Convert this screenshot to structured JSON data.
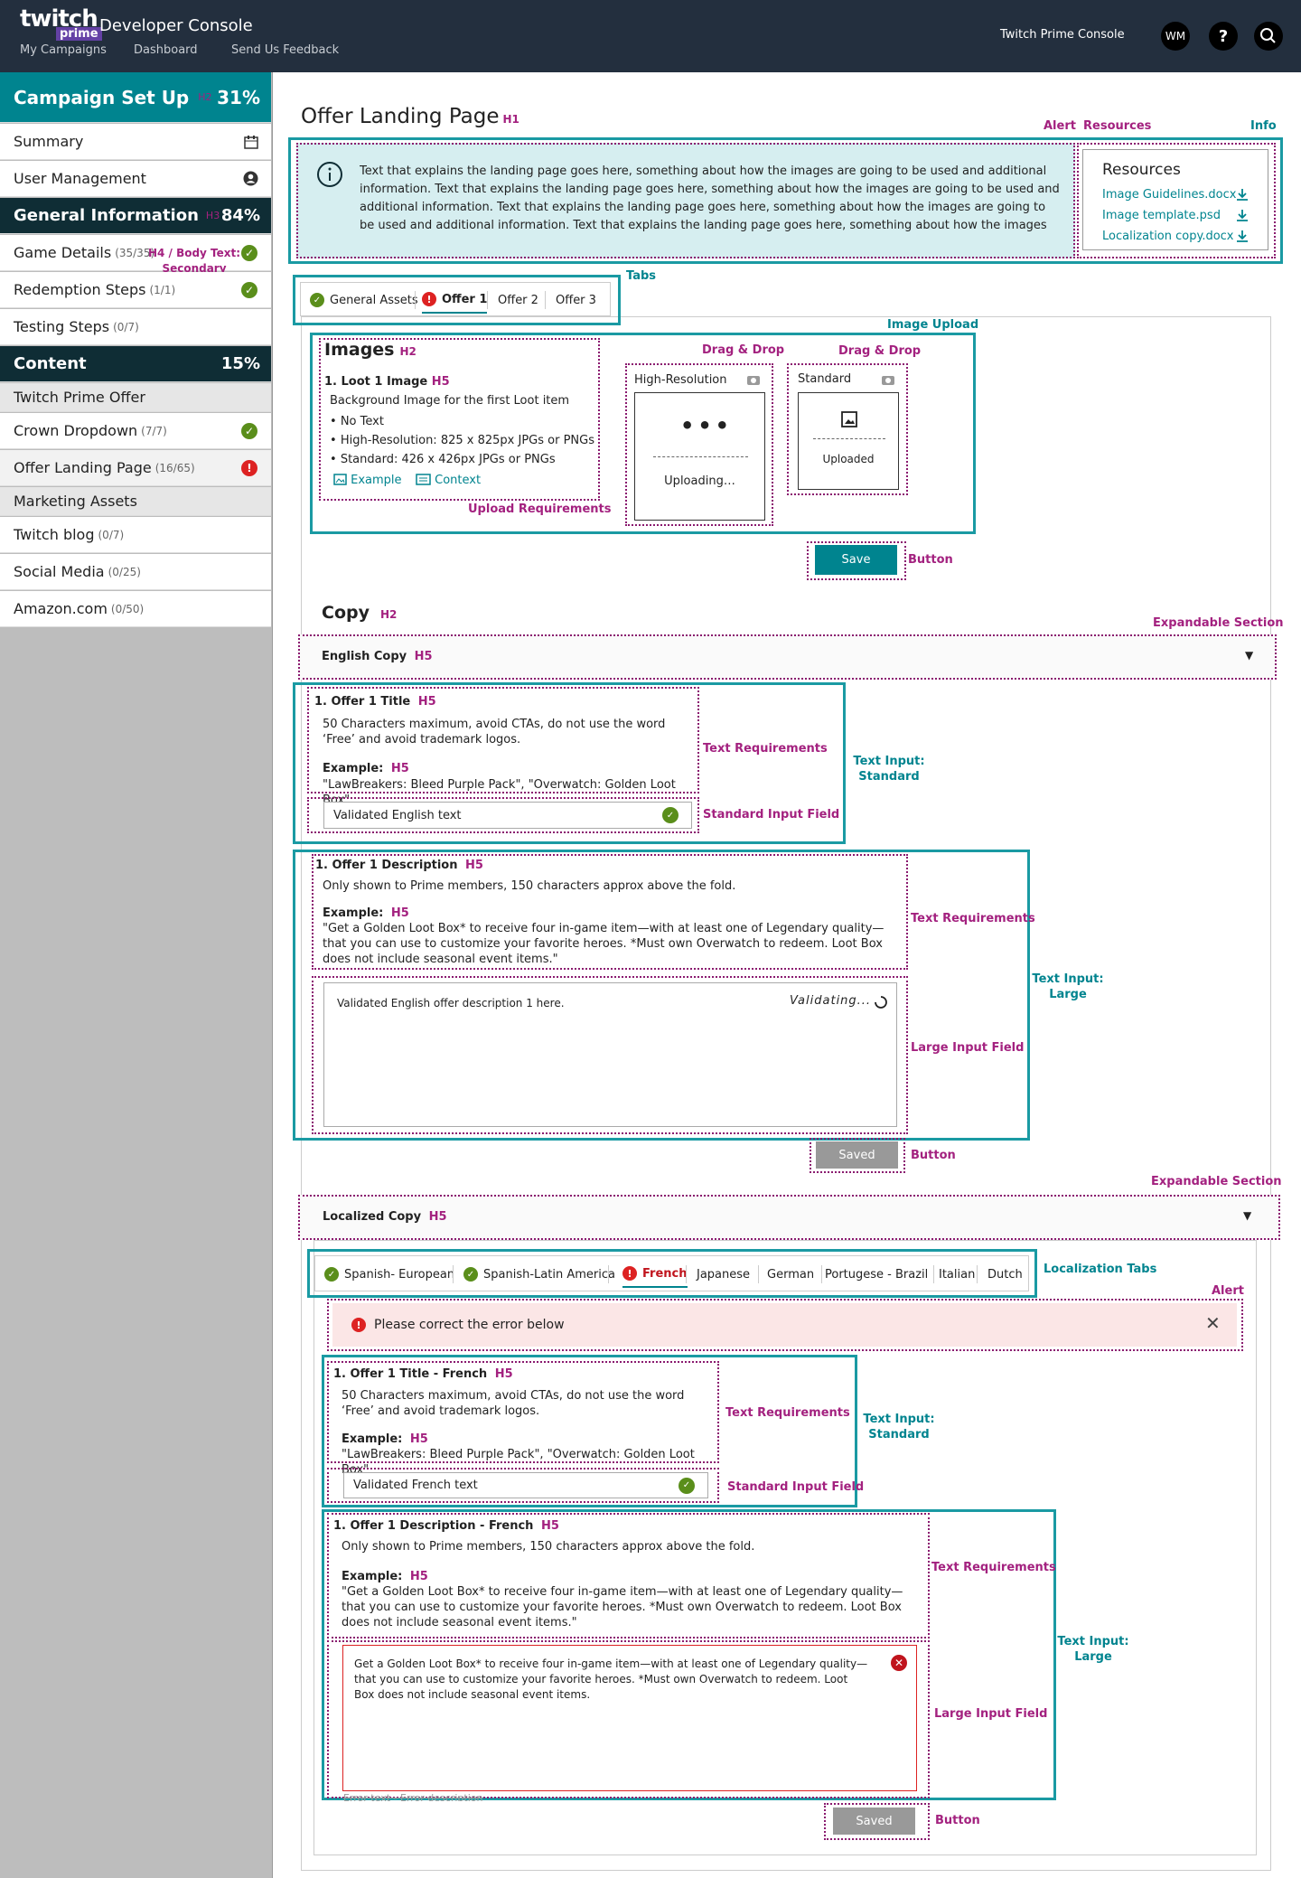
{
  "header": {
    "logo_main": "twitch",
    "logo_sub": "prime",
    "title": "Developer Console",
    "nav": [
      "My Campaigns",
      "Dashboard",
      "Send Us Feedback"
    ],
    "console_link": "Twitch Prime Console",
    "avatar": "WM",
    "help": "?"
  },
  "sidebar": {
    "campaign": {
      "label": "Campaign Set Up",
      "tag": "H2",
      "pct": "31%"
    },
    "summary": "Summary",
    "user_mgmt": "User Management",
    "general": {
      "label": "General Information",
      "tag": "H3",
      "pct": "84%"
    },
    "game_details": {
      "label": "Game Details",
      "count": "(35/35)"
    },
    "h4_note": "H4 / Body Text: Secondary",
    "redemption": {
      "label": "Redemption Steps",
      "count": "(1/1)"
    },
    "testing": {
      "label": "Testing Steps",
      "count": "(0/7)"
    },
    "content": {
      "label": "Content",
      "pct": "15%"
    },
    "twitch_prime_offer": "Twitch Prime Offer",
    "crown": {
      "label": "Crown Dropdown",
      "count": "(7/7)"
    },
    "offer_landing": {
      "label": "Offer Landing Page",
      "count": "(16/65)"
    },
    "marketing": "Marketing Assets",
    "twitch_blog": {
      "label": "Twitch blog",
      "count": "(0/7)"
    },
    "social": {
      "label": "Social Media",
      "count": "(0/25)"
    },
    "amazon": {
      "label": "Amazon.com",
      "count": "(0/50)"
    }
  },
  "page": {
    "title": "Offer Landing Page",
    "title_tag": "H1"
  },
  "annotations": {
    "alert": "Alert",
    "resources": "Resources",
    "info": "Info",
    "tabs": "Tabs",
    "image_upload": "Image Upload",
    "drag_drop": "Drag & Drop",
    "upload_req": "Upload Requirements",
    "button": "Button",
    "expandable": "Expandable Section",
    "text_req": "Text Requirements",
    "text_input_std": "Text Input: Standard",
    "std_field": "Standard Input Field",
    "text_input_large": "Text Input: Large",
    "large_field": "Large Input Field",
    "loc_tabs": "Localization Tabs"
  },
  "info": {
    "text": "Text that explains the landing page goes here, something about how the images are going to be used and additional information. Text that explains the landing page goes here, something about how the images are going to be used and additional information. Text that explains the landing page goes here, something about how the images are going to be used and additional information. Text that explains the landing page goes here, something about how the images are going to be used and additional information. Text that explains the landing page goes here, something about how the images are going to be used and additional information."
  },
  "resources": {
    "title": "Resources",
    "files": [
      "Image Guidelines.docx",
      "Image template.psd",
      "Localization copy.docx"
    ]
  },
  "tabs": [
    "General Assets",
    "Offer 1",
    "Offer 2",
    "Offer 3"
  ],
  "images": {
    "title": "Images",
    "tag": "H2",
    "item": "1. Loot 1 Image",
    "item_tag": "H5",
    "desc": "Background Image for the first Loot item",
    "bullets": [
      "No Text",
      "High-Resolution: 825 x 825px JPGs or PNGs",
      "Standard: 426 x 426px JPGs or PNGs"
    ],
    "example": "Example",
    "context": "Context",
    "hires": "High-Resolution",
    "uploading": "Uploading…",
    "standard": "Standard",
    "uploaded": "Uploaded"
  },
  "save": "Save",
  "copy": {
    "title": "Copy",
    "tag": "H2"
  },
  "english": {
    "label": "English Copy",
    "tag": "H5"
  },
  "offer_title": {
    "label": "1. Offer 1 Title",
    "tag": "H5",
    "req": "50 Characters maximum, avoid CTAs, do not use the word ‘Free’ and avoid trademark logos.",
    "ex_label": "Example:",
    "ex_tag": "H5",
    "ex": "\"LawBreakers: Bleed Purple Pack\", \"Overwatch: Golden Loot Box\"",
    "value": "Validated English text"
  },
  "offer_desc": {
    "label": "1. Offer 1 Description",
    "tag": "H5",
    "req": "Only shown to Prime members, 150 characters approx above the fold.",
    "ex_label": "Example:",
    "ex_tag": "H5",
    "ex": "\"Get a Golden Loot Box* to receive four in-game item—with at least one of Legendary quality—that you can use to customize your favorite heroes. *Must own Overwatch to redeem. Loot Box does not include seasonal event items.\"",
    "value": "Validated English offer description 1 here.",
    "status": "Validating..."
  },
  "saved": "Saved",
  "localized": {
    "label": "Localized Copy",
    "tag": "H5"
  },
  "loc_tabs": [
    "Spanish- European",
    "Spanish-Latin America",
    "French",
    "Japanese",
    "German",
    "Portugese - Brazil",
    "Italian",
    "Dutch"
  ],
  "alert": {
    "text": "Please correct the error below"
  },
  "fr_title": {
    "label": "1. Offer 1 Title - French",
    "tag": "H5",
    "req": "50 Characters maximum, avoid CTAs, do not use the word ‘Free’ and avoid trademark logos.",
    "ex_label": "Example:",
    "ex_tag": "H5",
    "ex": "\"LawBreakers: Bleed Purple Pack\", \"Overwatch: Golden Loot Box\"",
    "value": "Validated French text"
  },
  "fr_desc": {
    "label": "1. Offer 1 Description - French",
    "tag": "H5",
    "req": "Only shown to Prime members, 150 characters approx above the fold.",
    "ex_label": "Example:",
    "ex_tag": "H5",
    "ex": "\"Get a Golden Loot Box* to receive four in-game item—with at least one of Legendary quality—that you can use to customize your favorite heroes. *Must own Overwatch to redeem. Loot Box does not include seasonal event items.\"",
    "value": "Get a Golden Loot Box* to receive four in-game item—with at least one of Legendary quality—that you can use to customize your favorite heroes. *Must own Overwatch to redeem. Loot Box does not include seasonal event items.",
    "error": "Error text - Error description"
  },
  "colors": {
    "header": "#232f3e",
    "teal": "#00848f",
    "magenta": "#a3217f",
    "dark": "#0f2d35"
  }
}
